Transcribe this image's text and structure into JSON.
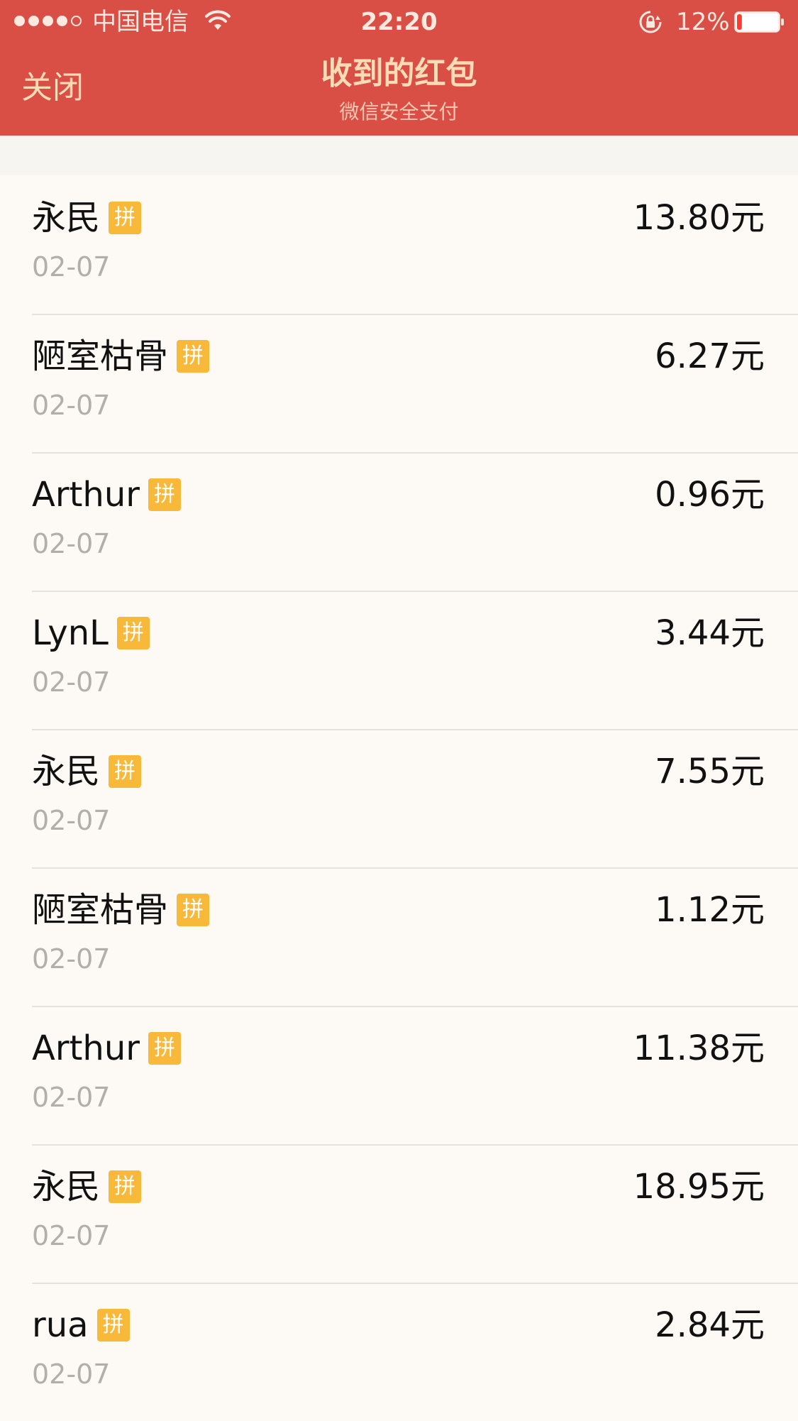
{
  "status_bar": {
    "carrier": "中国电信",
    "time": "22:20",
    "battery_percent": "12%",
    "battery_level": 0.12,
    "signal_strength": 4
  },
  "nav": {
    "close_label": "关闭",
    "title": "收到的红包",
    "subtitle": "微信安全支付"
  },
  "colors": {
    "header_bg": "#d94f45",
    "title_text": "#fcdcb6",
    "badge_bg": "#f8b93a",
    "date_text": "#b2afab",
    "battery_low": "#ff3b30"
  },
  "list": {
    "badge_label": "拼",
    "items": [
      {
        "name": "永民",
        "date": "02-07",
        "amount": "13.80元"
      },
      {
        "name": "陋室枯骨",
        "date": "02-07",
        "amount": "6.27元"
      },
      {
        "name": "Arthur",
        "date": "02-07",
        "amount": "0.96元"
      },
      {
        "name": "LynL",
        "date": "02-07",
        "amount": "3.44元"
      },
      {
        "name": "永民",
        "date": "02-07",
        "amount": "7.55元"
      },
      {
        "name": "陋室枯骨",
        "date": "02-07",
        "amount": "1.12元"
      },
      {
        "name": "Arthur",
        "date": "02-07",
        "amount": "11.38元"
      },
      {
        "name": "永民",
        "date": "02-07",
        "amount": "18.95元"
      },
      {
        "name": "rua",
        "date": "02-07",
        "amount": "2.84元"
      }
    ]
  }
}
